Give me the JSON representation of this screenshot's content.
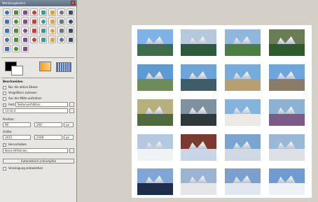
{
  "toolbox": {
    "title": "Werkzeugkasten",
    "tools": [
      "rect-select-icon",
      "ellipse-select-icon",
      "lasso-icon",
      "fuzzy-select-icon",
      "color-select-icon",
      "scissors-icon",
      "foreground-select-icon",
      "paths-icon",
      "color-picker-icon",
      "zoom-icon",
      "measure-icon",
      "move-icon",
      "align-icon",
      "crop-icon",
      "rotate-icon",
      "scale-icon",
      "shear-icon",
      "perspective-icon",
      "flip-icon",
      "cage-icon",
      "text-icon",
      "bucket-fill-icon",
      "blend-icon",
      "pencil-icon",
      "paintbrush-icon",
      "eraser-icon",
      "airbrush-icon",
      "ink-icon",
      "clone-icon",
      "heal-icon",
      "perspective-clone-icon",
      "smudge-icon",
      "dodge-burn-icon",
      "blur-icon",
      "extra-tool-icon"
    ],
    "colors": {
      "foreground": "#000000",
      "background": "#ffffff"
    }
  },
  "options": {
    "title": "Beschneiden",
    "checkbox_1": "Nur die aktive Ebene",
    "checkbox_2": "Vergrößern zulassen",
    "checkbox_3": "Aus der Mitte aufziehen",
    "fixed_label": "Fest:",
    "fixed_value": "Seitenverhältnis",
    "ratio_value": "13:10.4",
    "position_label": "Position:",
    "position_unit": "px",
    "position_x": "90",
    "position_y": "200",
    "size_label": "Größe:",
    "size_unit": "px",
    "size_w": "3415",
    "size_h": "2548",
    "highlight_label": "Hervorheben",
    "guides_value": "Keine Hilfslinien",
    "auto_shrink_button": "Automatisch schrumpfen",
    "merge_label": "Vereinigung einbeziehen"
  },
  "canvas": {
    "sheet": "#ffffff"
  },
  "photos": [
    {
      "name": "thumb-1",
      "sky": "#7fb3e8",
      "ground": "#3f6c4b"
    },
    {
      "name": "thumb-2",
      "sky": "#b7c8da",
      "ground": "#2c5a3a"
    },
    {
      "name": "thumb-3",
      "sky": "#92b7dd",
      "ground": "#4b7f42"
    },
    {
      "name": "thumb-4",
      "sky": "#6b7d57",
      "ground": "#2f5a2b"
    },
    {
      "name": "thumb-5",
      "sky": "#5f9ad0",
      "ground": "#6e8c57"
    },
    {
      "name": "thumb-6",
      "sky": "#6fa4d8",
      "ground": "#3f5d69"
    },
    {
      "name": "thumb-7",
      "sky": "#76acdc",
      "ground": "#b6a072"
    },
    {
      "name": "thumb-8",
      "sky": "#6ea6dc",
      "ground": "#8b7b67"
    },
    {
      "name": "thumb-9",
      "sky": "#b6b07f",
      "ground": "#4f6b3e"
    },
    {
      "name": "thumb-10",
      "sky": "#7f909f",
      "ground": "#2e3a3a"
    },
    {
      "name": "thumb-11",
      "sky": "#86b3dd",
      "ground": "#ede9e5"
    },
    {
      "name": "thumb-12",
      "sky": "#8db1d3",
      "ground": "#7c5b88"
    },
    {
      "name": "thumb-13",
      "sky": "#b4c8e0",
      "ground": "#f1f2f4"
    },
    {
      "name": "thumb-14",
      "sky": "#7a3a2f",
      "ground": "#c8d6e8"
    },
    {
      "name": "thumb-15",
      "sky": "#7aa5d0",
      "ground": "#d0d8e3"
    },
    {
      "name": "thumb-16",
      "sky": "#9bb7d6",
      "ground": "#dde1e5"
    },
    {
      "name": "thumb-17",
      "sky": "#7fa6d4",
      "ground": "#1d2d4a"
    },
    {
      "name": "thumb-18",
      "sky": "#9bb4d1",
      "ground": "#e6e5e8"
    },
    {
      "name": "thumb-19",
      "sky": "#7ca0ce",
      "ground": "#e1e7ef"
    },
    {
      "name": "thumb-20",
      "sky": "#6f9bd1",
      "ground": "#eef2f7"
    }
  ]
}
